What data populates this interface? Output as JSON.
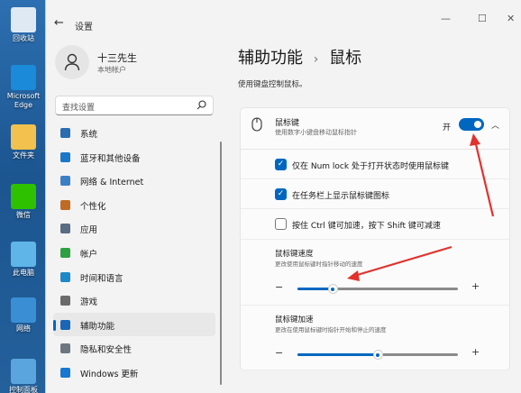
{
  "desktop": {
    "icons": [
      {
        "label": "回收站",
        "color": "#dfe9f3"
      },
      {
        "label": "Microsoft Edge",
        "color": "#1b8ad8"
      },
      {
        "label": "文件夹",
        "color": "#f2c14e"
      },
      {
        "label": "微信",
        "color": "#2dc100"
      },
      {
        "label": "此电脑",
        "color": "#5fb5e8"
      },
      {
        "label": "网络",
        "color": "#3a8fd4"
      },
      {
        "label": "控制面板",
        "color": "#5aa5de"
      }
    ]
  },
  "window": {
    "title": "设置",
    "back_icon": "back-arrow-icon",
    "controls": [
      "—",
      "☐",
      "✕"
    ]
  },
  "user": {
    "name": "十三先生",
    "type": "本地帐户"
  },
  "search": {
    "placeholder": "查找设置"
  },
  "nav": [
    {
      "label": "系统",
      "icon": "system-icon",
      "color": "#2b6cb0"
    },
    {
      "label": "蓝牙和其他设备",
      "icon": "bluetooth-icon",
      "color": "#1d77c9"
    },
    {
      "label": "网络 & Internet",
      "icon": "network-icon",
      "color": "#3d7fc4"
    },
    {
      "label": "个性化",
      "icon": "personalization-icon",
      "color": "#c06b25"
    },
    {
      "label": "应用",
      "icon": "apps-icon",
      "color": "#5a6c84"
    },
    {
      "label": "帐户",
      "icon": "accounts-icon",
      "color": "#2ea043"
    },
    {
      "label": "时间和语言",
      "icon": "time-language-icon",
      "color": "#1e88c9"
    },
    {
      "label": "游戏",
      "icon": "gaming-icon",
      "color": "#6b6b6b"
    },
    {
      "label": "辅助功能",
      "icon": "accessibility-icon",
      "color": "#1a66b5",
      "active": true
    },
    {
      "label": "隐私和安全性",
      "icon": "privacy-icon",
      "color": "#6e7780"
    },
    {
      "label": "Windows 更新",
      "icon": "windows-update-icon",
      "color": "#1877d0"
    }
  ],
  "main": {
    "breadcrumb_parent": "辅助功能",
    "breadcrumb_sep": "›",
    "breadcrumb_current": "鼠标",
    "description": "使用键盘控制鼠标。",
    "mouse_keys": {
      "title": "鼠标键",
      "description": "使用数字小键盘移动鼠标指针",
      "state_label": "开",
      "enabled": true
    },
    "options": [
      {
        "label": "仅在 Num lock 处于打开状态时使用鼠标键",
        "checked": true
      },
      {
        "label": "在任务栏上显示鼠标键图标",
        "checked": true
      },
      {
        "label": "按住 Ctrl 键可加速，按下 Shift 键可减速",
        "checked": false
      }
    ],
    "speed": {
      "title": "鼠标键速度",
      "description": "更改使用鼠标键时指针移动的速度",
      "value": 0.22
    },
    "acceleration": {
      "title": "鼠标键加速",
      "description": "更改在使用鼠标键时指针开始和停止的速度",
      "value": 0.5
    }
  },
  "colors": {
    "accent": "#0067c0",
    "annotation": "#e3312d"
  }
}
